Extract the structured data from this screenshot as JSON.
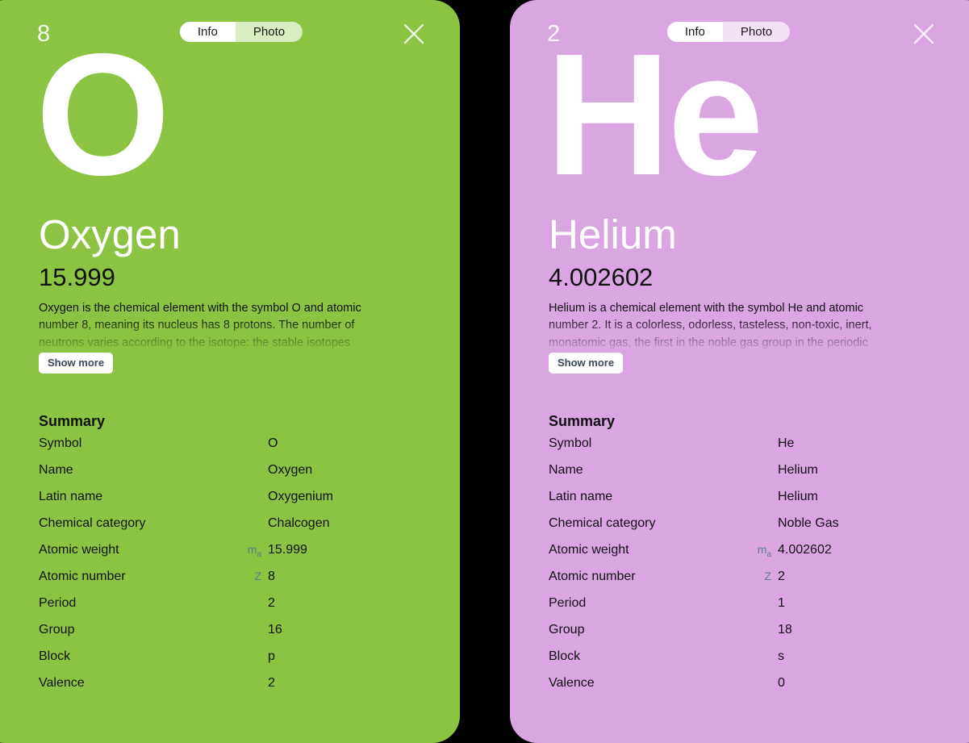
{
  "cards": [
    {
      "accent_color": "#8cc342",
      "atomic_number_badge": "8",
      "toggle": {
        "active": "Info",
        "inactive": "Photo"
      },
      "close_icon": "close-icon",
      "symbol": "O",
      "name": "Oxygen",
      "weight": "15.999",
      "description": "Oxygen is the chemical element with the symbol O and atomic number 8, meaning its nucleus has 8 protons. The number of neutrons varies according to the isotope: the stable isotopes",
      "show_more_label": "Show more",
      "summary_title": "Summary",
      "summary_rows": [
        {
          "label": "Symbol",
          "sym": "",
          "value": "O"
        },
        {
          "label": "Name",
          "sym": "",
          "value": "Oxygen"
        },
        {
          "label": "Latin name",
          "sym": "",
          "value": "Oxygenium"
        },
        {
          "label": "Chemical category",
          "sym": "",
          "value": "Chalcogen"
        },
        {
          "label": "Atomic weight",
          "sym": "ma",
          "value": "15.999"
        },
        {
          "label": "Atomic number",
          "sym": "Z",
          "value": "8"
        },
        {
          "label": "Period",
          "sym": "",
          "value": "2"
        },
        {
          "label": "Group",
          "sym": "",
          "value": "16"
        },
        {
          "label": "Block",
          "sym": "",
          "value": "p"
        },
        {
          "label": "Valence",
          "sym": "",
          "value": "2"
        }
      ]
    },
    {
      "accent_color": "#d9a6e2",
      "atomic_number_badge": "2",
      "toggle": {
        "active": "Info",
        "inactive": "Photo"
      },
      "close_icon": "close-icon",
      "symbol": "He",
      "name": "Helium",
      "weight": "4.002602",
      "description": "Helium is a chemical element with the symbol He and atomic number 2. It is a colorless, odorless, tasteless, non-toxic, inert, monatomic gas, the first in the noble gas group in the periodic",
      "show_more_label": "Show more",
      "summary_title": "Summary",
      "summary_rows": [
        {
          "label": "Symbol",
          "sym": "",
          "value": "He"
        },
        {
          "label": "Name",
          "sym": "",
          "value": "Helium"
        },
        {
          "label": "Latin name",
          "sym": "",
          "value": "Helium"
        },
        {
          "label": "Chemical category",
          "sym": "",
          "value": "Noble Gas"
        },
        {
          "label": "Atomic weight",
          "sym": "ma",
          "value": "4.002602"
        },
        {
          "label": "Atomic number",
          "sym": "Z",
          "value": "2"
        },
        {
          "label": "Period",
          "sym": "",
          "value": "1"
        },
        {
          "label": "Group",
          "sym": "",
          "value": "18"
        },
        {
          "label": "Block",
          "sym": "",
          "value": "s"
        },
        {
          "label": "Valence",
          "sym": "",
          "value": "0"
        }
      ]
    }
  ]
}
